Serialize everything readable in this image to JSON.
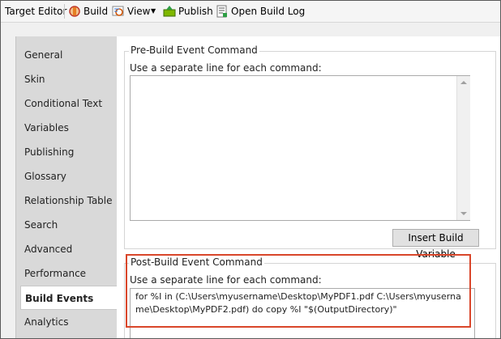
{
  "toolbar": {
    "title": "Target Editor",
    "build": "Build",
    "view": "View",
    "publish": "Publish",
    "open_log": "Open Build Log"
  },
  "nav": {
    "items": [
      "General",
      "Skin",
      "Conditional Text",
      "Variables",
      "Publishing",
      "Glossary",
      "Relationship Table",
      "Search",
      "Advanced",
      "Performance",
      "Build Events",
      "Analytics"
    ],
    "active": "Build Events"
  },
  "pre_build": {
    "title": "Pre-Build Event Command",
    "hint": "Use a separate line for each command:",
    "value": "",
    "button": "Insert Build Variable"
  },
  "post_build": {
    "title": "Post-Build Event Command",
    "hint": "Use a separate line for each command:",
    "value": "for %I in (C:\\Users\\myusername\\Desktop\\MyPDF1.pdf C:\\Users\\myusername\\Desktop\\MyPDF2.pdf) do copy %I \"$(OutputDirectory)\""
  },
  "colors": {
    "highlight": "#d9462a",
    "nav_bg": "#d9d9d9",
    "active_bg": "#ffffff"
  }
}
